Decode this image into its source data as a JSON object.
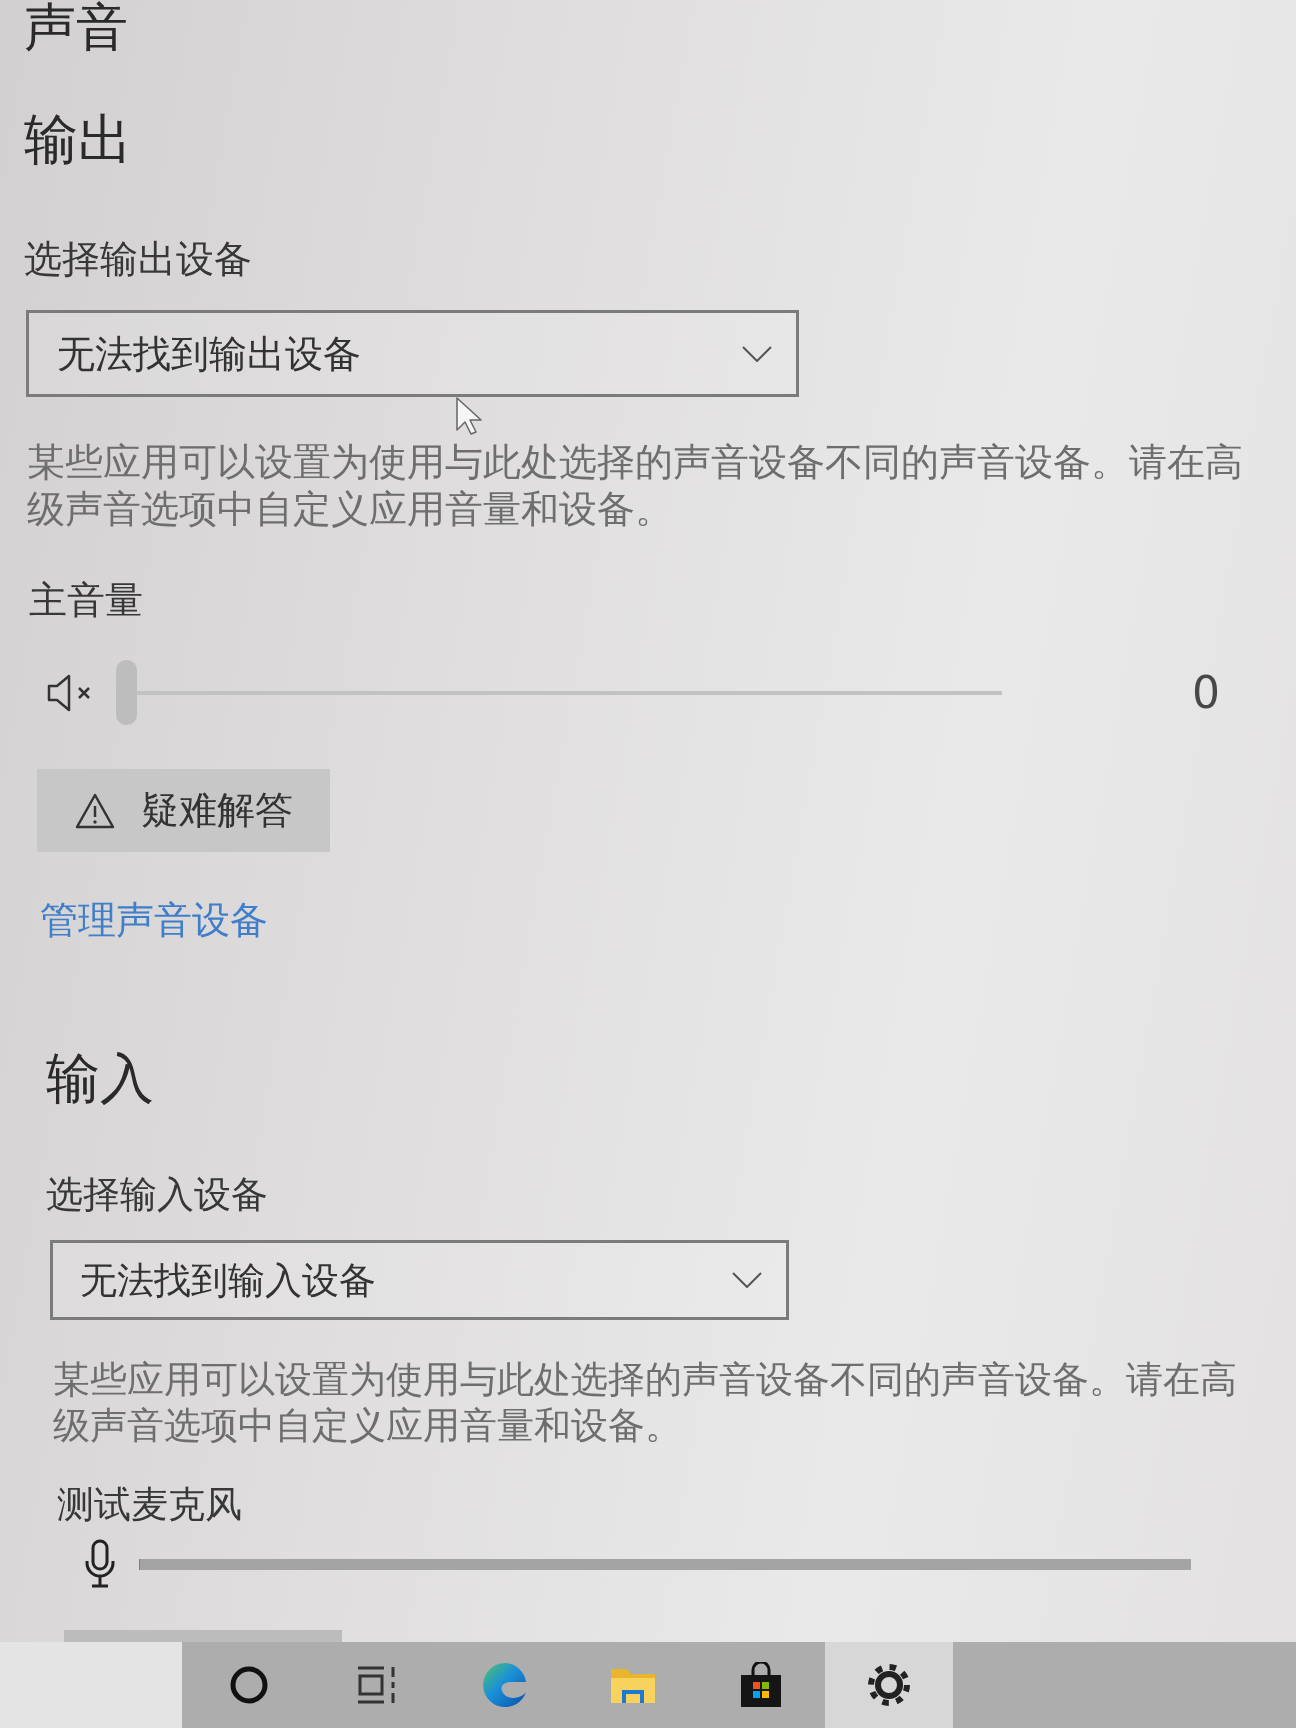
{
  "page_title": "声音",
  "output": {
    "heading": "输出",
    "device_label": "选择输出设备",
    "device_dropdown": {
      "value": "无法找到输出设备"
    },
    "description": "某些应用可以设置为使用与此处选择的声音设备不同的声音设备。请在高级声音选项中自定义应用音量和设备。",
    "volume": {
      "label": "主音量",
      "muted": true,
      "level": 0,
      "reading": "0"
    },
    "troubleshoot_button": {
      "label": "疑难解答"
    },
    "manage_link": "管理声音设备"
  },
  "input": {
    "heading": "输入",
    "device_label": "选择输入设备",
    "device_dropdown": {
      "value": "无法找到输入设备"
    },
    "description": "某些应用可以设置为使用与此处选择的声音设备不同的声音设备。请在高级声音选项中自定义应用音量和设备。",
    "mic_test": {
      "label": "测试麦克风",
      "level": 0
    }
  },
  "taskbar": {
    "items": [
      {
        "kind": "cortana",
        "selected": false
      },
      {
        "kind": "task_view",
        "selected": false
      },
      {
        "kind": "browser",
        "selected": false
      },
      {
        "kind": "file_explorer",
        "selected": false
      },
      {
        "kind": "store",
        "selected": false
      },
      {
        "kind": "settings",
        "selected": true
      }
    ]
  }
}
